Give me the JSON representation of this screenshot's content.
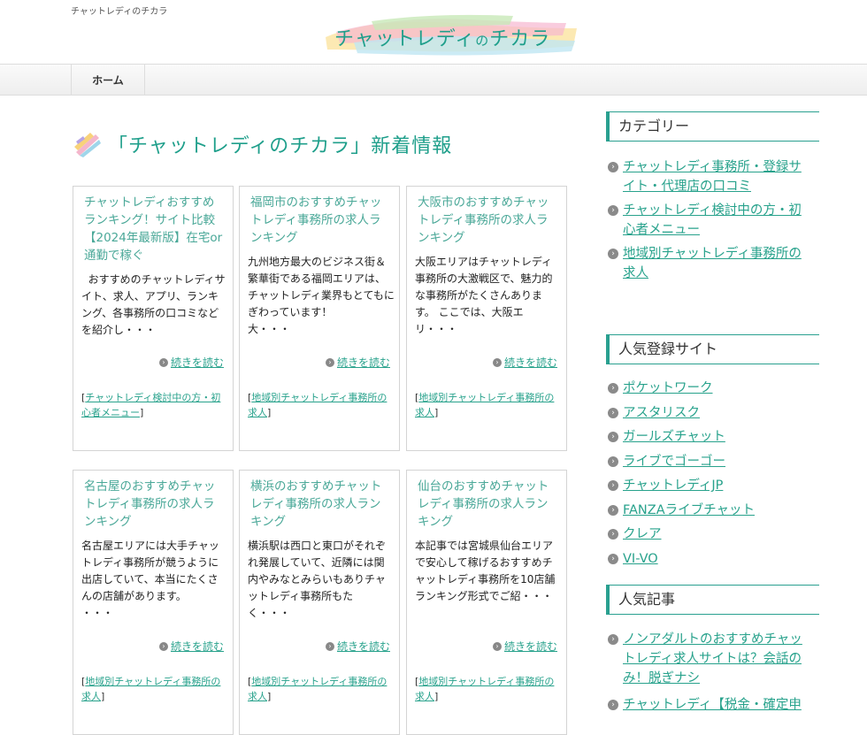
{
  "header": {
    "tagline": "チャットレディのチカラ",
    "logo_text_a": "チャットレディ",
    "logo_text_b": "の",
    "logo_text_c": "チカラ"
  },
  "nav": {
    "home": "ホーム"
  },
  "main": {
    "title": "「チャットレディのチカラ」新着情報",
    "read_more": "続きを読む",
    "cards": [
      {
        "title": "チャットレディおすすめランキング！サイト比較【2024年最新版】在宅or通勤で稼ぐ",
        "excerpt": "  おすすめのチャットレディサイト、求人、アプリ、ランキング、各事務所の口コミなどを紹介し・・・",
        "category": "チャットレディ検討中の方・初心者メニュー"
      },
      {
        "title": "福岡市のおすすめチャットレディ事務所の求人ランキング",
        "excerpt": "九州地方最大のビジネス街＆繁華街である福岡エリアは、チャットレディ業界もとてもにぎわっています！\n大・・・",
        "category": "地域別チャットレディ事務所の求人"
      },
      {
        "title": "大阪市のおすすめチャットレディ事務所の求人ランキング",
        "excerpt": "大阪エリアはチャットレディ事務所の大激戦区で、魅力的な事務所がたくさんあります。 ここでは、大阪エリ・・・",
        "category": "地域別チャットレディ事務所の求人"
      },
      {
        "title": "名古屋のおすすめチャットレディ事務所の求人ランキング",
        "excerpt": "名古屋エリアには大手チャットレディ事務所が競うように出店していて、本当にたくさんの店舗があります。\n・・・",
        "category": "地域別チャットレディ事務所の求人"
      },
      {
        "title": "横浜のおすすめチャットレディ事務所の求人ランキング",
        "excerpt": "横浜駅は西口と東口がそれぞれ発展していて、近隣には関内やみなとみらいもありチャットレディ事務所もたく・・・",
        "category": "地域別チャットレディ事務所の求人"
      },
      {
        "title": "仙台のおすすめチャットレディ事務所の求人ランキング",
        "excerpt": "本記事では宮城県仙台エリアで安心して稼げるおすすめチャットレディ事務所を10店舗ランキング形式でご紹・・・",
        "category": "地域別チャットレディ事務所の求人"
      }
    ]
  },
  "sidebar": {
    "categories": {
      "title": "カテゴリー",
      "items": [
        "チャットレディ事務所・登録サイト・代理店の口コミ",
        "チャットレディ検討中の方・初心者メニュー",
        "地域別チャットレディ事務所の求人"
      ]
    },
    "popular_sites": {
      "title": "人気登録サイト",
      "items": [
        "ポケットワーク",
        "アスタリスク",
        "ガールズチャット",
        "ライブでゴーゴー",
        "チャットレディJP",
        "FANZAライブチャット",
        "クレア",
        "VI-VO"
      ]
    },
    "popular_articles": {
      "title": "人気記事",
      "items": [
        "ノンアダルトのおすすめチャットレディ求人サイトは？会話のみ！脱ぎナシ",
        "チャットレディ【税金・確定申"
      ]
    }
  },
  "colors": {
    "accent": "#1f9f8b",
    "link": "#28a28c",
    "border": "#d4d4d4"
  }
}
